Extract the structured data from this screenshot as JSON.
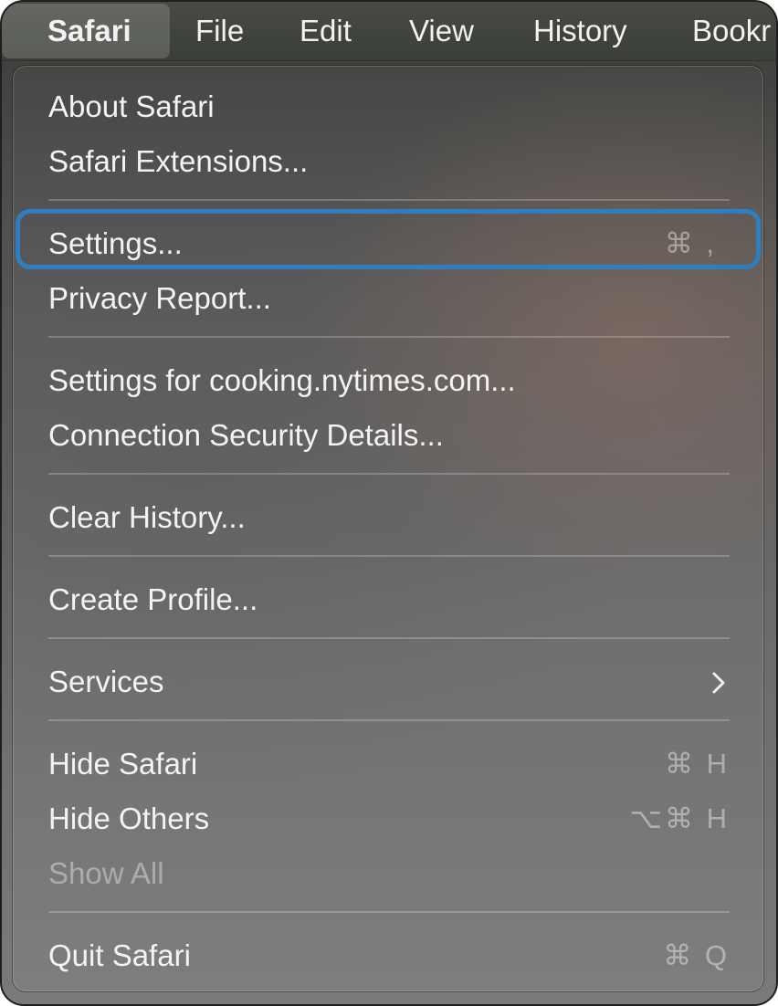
{
  "menubar": {
    "items": [
      "Safari",
      "File",
      "Edit",
      "View",
      "History",
      "Bookr"
    ]
  },
  "menu": {
    "about": {
      "label": "About Safari"
    },
    "extensions": {
      "label": "Safari Extensions..."
    },
    "settings": {
      "label": "Settings...",
      "shortcut": "⌘ ,"
    },
    "privacy_report": {
      "label": "Privacy Report..."
    },
    "site_settings": {
      "label": "Settings for cooking.nytimes.com..."
    },
    "connection_security": {
      "label": "Connection Security Details..."
    },
    "clear_history": {
      "label": "Clear History..."
    },
    "create_profile": {
      "label": "Create Profile..."
    },
    "services": {
      "label": "Services",
      "submenu_icon": "chevron-right-icon"
    },
    "hide_safari": {
      "label": "Hide Safari",
      "shortcut": "⌘ H"
    },
    "hide_others": {
      "label": "Hide Others",
      "shortcut": "⌥⌘ H"
    },
    "show_all": {
      "label": "Show All",
      "enabled": false
    },
    "quit": {
      "label": "Quit Safari",
      "shortcut": "⌘ Q"
    }
  },
  "colors": {
    "highlight_outline": "#2e7fc2",
    "menubar_bg": "#3f433d"
  }
}
